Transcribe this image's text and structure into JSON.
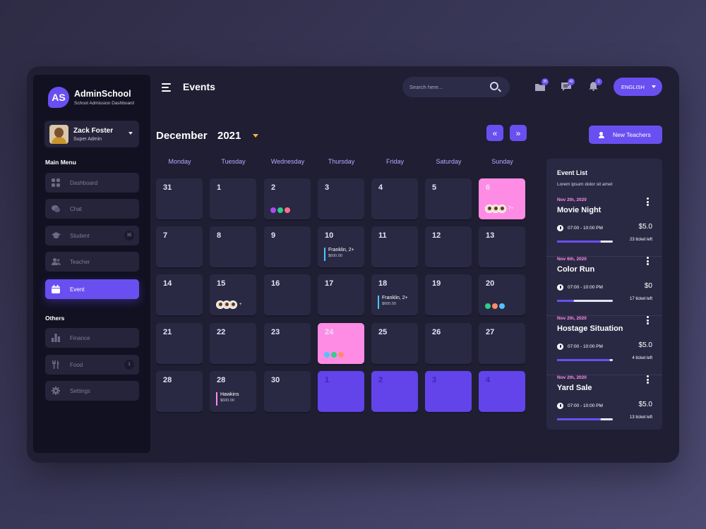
{
  "brand": {
    "logo": "AS",
    "name": "AdminSchool",
    "subtitle": "School Admission Dashboard"
  },
  "profile": {
    "name": "Zack Foster",
    "role": "Super Admin"
  },
  "sidebar": {
    "main_menu_title": "Main Menu",
    "main_items": [
      {
        "label": "Dashboard",
        "icon": "grid-icon",
        "badge": ""
      },
      {
        "label": "Chat",
        "icon": "chat-icon",
        "badge": ""
      },
      {
        "label": "Student",
        "icon": "graduation-cap-icon",
        "badge": "35"
      },
      {
        "label": "Teacher",
        "icon": "users-icon",
        "badge": ""
      },
      {
        "label": "Event",
        "icon": "calendar-icon",
        "badge": "",
        "active": true
      }
    ],
    "others_title": "Others",
    "other_items": [
      {
        "label": "Finance",
        "icon": "bar-chart-icon",
        "badge": ""
      },
      {
        "label": "Food",
        "icon": "utensils-icon",
        "badge": "1"
      },
      {
        "label": "Settings",
        "icon": "gear-icon",
        "badge": ""
      }
    ]
  },
  "header": {
    "title": "Events",
    "search_placeholder": "Search here...",
    "notifications": {
      "mail": "35",
      "chat": "42",
      "bell": "1"
    },
    "language": "ENGLISH"
  },
  "calendar": {
    "month": "December",
    "year": "2021",
    "prev": "«",
    "next": "»",
    "weekdays": [
      "Monday",
      "Tuesday",
      "Wednesday",
      "Thursday",
      "Friday",
      "Saturday",
      "Sunday"
    ],
    "days": [
      {
        "n": "31"
      },
      {
        "n": "1"
      },
      {
        "n": "2",
        "dots": [
          "#a94cf0",
          "#2fcf86",
          "#ff6f8a"
        ]
      },
      {
        "n": "3"
      },
      {
        "n": "4"
      },
      {
        "n": "5"
      },
      {
        "n": "6",
        "style": "pink",
        "avatars": 3,
        "more": "7+"
      },
      {
        "n": "7"
      },
      {
        "n": "8"
      },
      {
        "n": "9"
      },
      {
        "n": "10",
        "event": {
          "title": "Franklin, 2+",
          "price": "$600.00",
          "color": "#4fc4ff"
        }
      },
      {
        "n": "11"
      },
      {
        "n": "12"
      },
      {
        "n": "13"
      },
      {
        "n": "14"
      },
      {
        "n": "15",
        "avatars": 3,
        "more": "+"
      },
      {
        "n": "16"
      },
      {
        "n": "17"
      },
      {
        "n": "18",
        "event": {
          "title": "Franklin, 2+",
          "price": "$600.00",
          "color": "#4fc4ff"
        }
      },
      {
        "n": "19"
      },
      {
        "n": "20",
        "dots": [
          "#2fcf86",
          "#ff8a6a",
          "#4fc4ff"
        ]
      },
      {
        "n": "21"
      },
      {
        "n": "22"
      },
      {
        "n": "23"
      },
      {
        "n": "24",
        "style": "pink",
        "dots": [
          "#4fc4ff",
          "#2fcf86",
          "#ff8a6a"
        ]
      },
      {
        "n": "25"
      },
      {
        "n": "26"
      },
      {
        "n": "27"
      },
      {
        "n": "28"
      },
      {
        "n": "28",
        "event": {
          "title": "Hawkins",
          "price": "$600.00",
          "color": "#ff8ce4"
        }
      },
      {
        "n": "30"
      },
      {
        "n": "1",
        "style": "purple"
      },
      {
        "n": "2",
        "style": "purple"
      },
      {
        "n": "3",
        "style": "purple"
      },
      {
        "n": "4",
        "style": "purple"
      }
    ]
  },
  "new_teachers_label": "New Teachers",
  "event_list": {
    "title": "Event List",
    "subtitle": "Lorem ipsum dolor sit amet",
    "events": [
      {
        "date": "Nov 2th, 2020",
        "name": "Movie Night",
        "time": "07:00 - 10:00 PM",
        "price": "$5.0",
        "tickets_left": "23 ticket left",
        "progress": 0.78
      },
      {
        "date": "Nov 6th, 2020",
        "name": "Color Run",
        "time": "07:00 - 10:00 PM",
        "price": "$0",
        "tickets_left": "17 ticket left",
        "progress": 0.3
      },
      {
        "date": "Nov 2th, 2020",
        "name": "Hostage Situation",
        "time": "07:00 - 10:00 PM",
        "price": "$5.0",
        "tickets_left": "4 ticket left",
        "progress": 0.95
      },
      {
        "date": "Nov 2th, 2020",
        "name": "Yard Sale",
        "time": "07:00 - 10:00 PM",
        "price": "$5.0",
        "tickets_left": "13 ticket left",
        "progress": 0.78
      }
    ]
  }
}
